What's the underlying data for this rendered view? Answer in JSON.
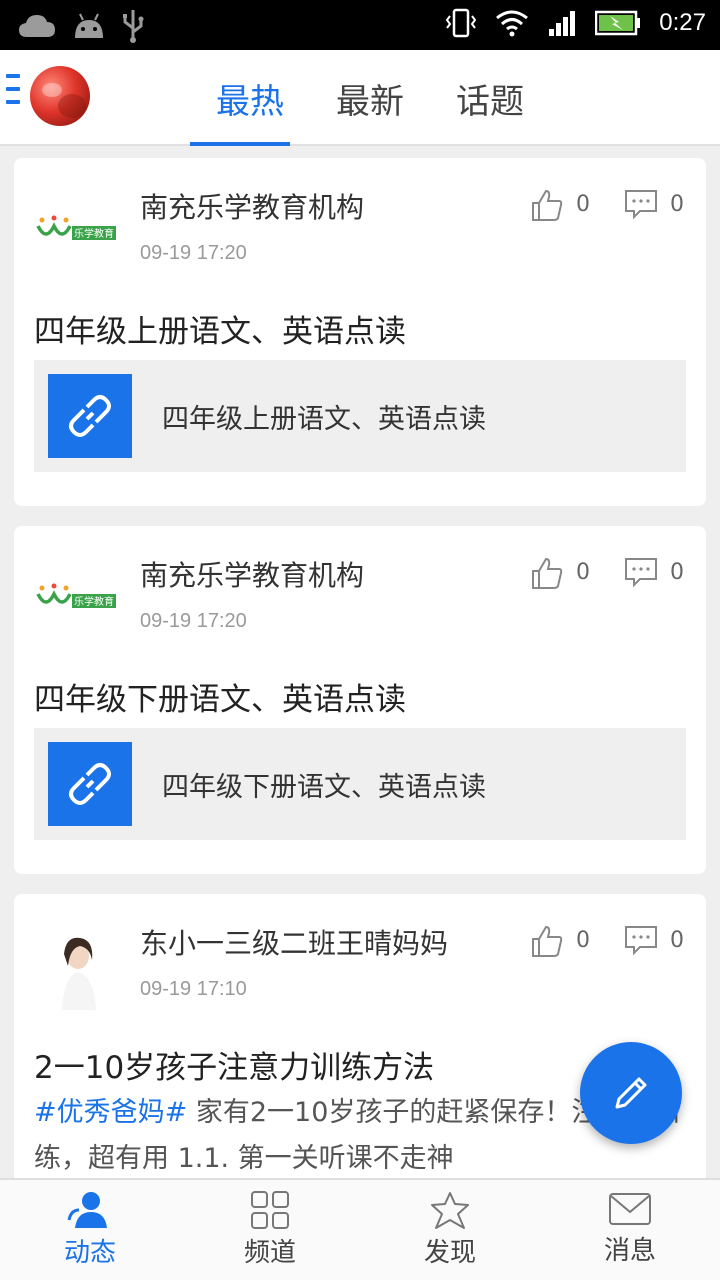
{
  "status_bar": {
    "time": "0:27",
    "left_icons": [
      "cloud-icon",
      "android-icon",
      "usb-icon"
    ],
    "right_icons": [
      "vibrate-icon",
      "wifi-icon",
      "signal-icon",
      "battery-icon"
    ]
  },
  "top_nav": {
    "menu_icon": "menu-icon",
    "tabs": [
      {
        "label": "最热",
        "active": true
      },
      {
        "label": "最新",
        "active": false
      },
      {
        "label": "话题",
        "active": false
      }
    ]
  },
  "feed": [
    {
      "author": "南充乐学教育机构",
      "time": "09-19 17:20",
      "likes": "0",
      "comments": "0",
      "title": "四年级上册语文、英语点读",
      "link_text": "四年级上册语文、英语点读",
      "logo_text": "乐学教育"
    },
    {
      "author": "南充乐学教育机构",
      "time": "09-19 17:20",
      "likes": "0",
      "comments": "0",
      "title": "四年级下册语文、英语点读",
      "link_text": "四年级下册语文、英语点读",
      "logo_text": "乐学教育"
    },
    {
      "author": "东小一三级二班王晴妈妈",
      "time": "09-19 17:10",
      "likes": "0",
      "comments": "0",
      "title": "2一10岁孩子注意力训练方法",
      "hashtag": "#优秀爸妈#",
      "body": " 家有2一10岁孩子的赶紧保存！注意力训练，超有用 1.1. 第一关听课不走神"
    }
  ],
  "bottom_nav": [
    {
      "label": "动态",
      "icon": "person-icon",
      "active": true
    },
    {
      "label": "频道",
      "icon": "grid-icon",
      "active": false
    },
    {
      "label": "发现",
      "icon": "star-icon",
      "active": false
    },
    {
      "label": "消息",
      "icon": "mail-icon",
      "active": false
    }
  ],
  "colors": {
    "accent": "#1a73e8",
    "background": "#efefef",
    "card": "#ffffff"
  }
}
